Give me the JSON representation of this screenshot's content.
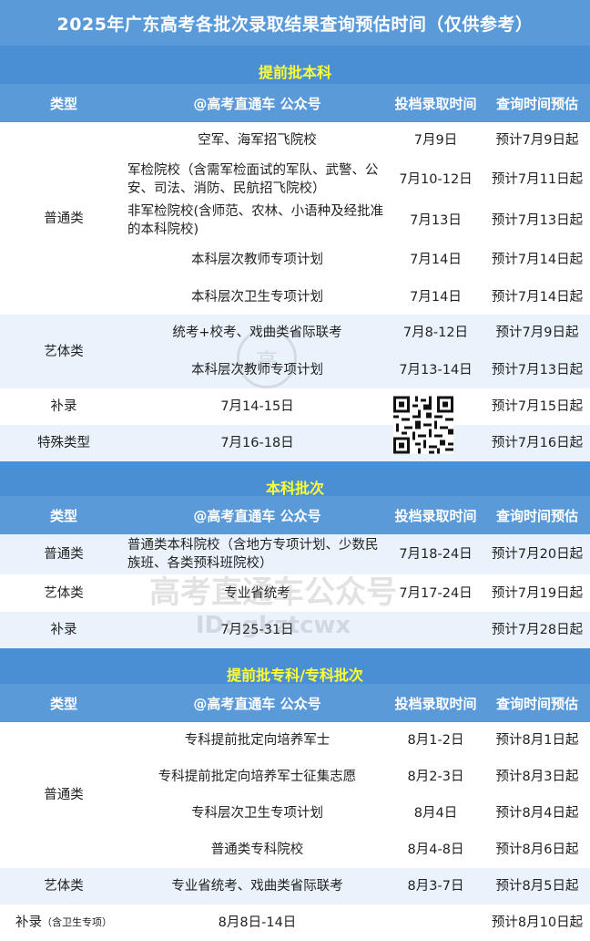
{
  "title": "2025年广东高考各批次录取结果查询预估时间（仅供参考）",
  "headers": {
    "type": "类型",
    "account": "@高考直通车 公众号",
    "admit": "投档录取时间",
    "query": "查询时间预估"
  },
  "sections": [
    {
      "title": "提前批本科"
    },
    {
      "title": "本科批次"
    },
    {
      "title": "提前批专科/专科批次"
    }
  ],
  "sec1": {
    "putong": "普通类",
    "r1": {
      "name": "空军、海军招飞院校",
      "time": "7月9日",
      "query": "预计7月9日起"
    },
    "r2": {
      "name": "军检院校（含需军检面试的军队、武警、公安、司法、消防、民航招飞院校）",
      "time": "7月10-12日",
      "query": "预计7月11日起"
    },
    "r3": {
      "name": "非军检院校(含师范、农林、小语种及经批准的本科院校)",
      "time": "7月13日",
      "query": "预计7月13日起"
    },
    "r4": {
      "name": "本科层次教师专项计划",
      "time": "7月14日",
      "query": "预计7月14日起"
    },
    "r5": {
      "name": "本科层次卫生专项计划",
      "time": "7月14日",
      "query": "预计7月14日起"
    },
    "yiti": "艺体类",
    "r6": {
      "name": "统考+校考、戏曲类省际联考",
      "time": "7月8-12日",
      "query": "预计7月9日起"
    },
    "r7": {
      "name": "本科层次教师专项计划",
      "time": "7月13-14日",
      "query": "预计7月13日起"
    },
    "bulu": {
      "type": "补录",
      "time": "7月14-15日",
      "query": "预计7月15日起"
    },
    "teshu": {
      "type": "特殊类型",
      "time": "7月16-18日",
      "query": "预计7月16日起"
    }
  },
  "sec2": {
    "r1": {
      "type": "普通类",
      "name": "普通类本科院校（含地方专项计划、少数民族班、各类预科班院校）",
      "time": "7月18-24日",
      "query": "预计7月20日起"
    },
    "r2": {
      "type": "艺体类",
      "name": "专业省统考",
      "time": "7月17-24日",
      "query": "预计7月19日起"
    },
    "r3": {
      "type": "补录",
      "time": "7月25-31日",
      "query": "预计7月28日起"
    }
  },
  "sec3": {
    "putong": "普通类",
    "r1": {
      "name": "专科提前批定向培养军士",
      "time": "8月1-2日",
      "query": "预计8月1日起"
    },
    "r2": {
      "name": "专科提前批定向培养军士征集志愿",
      "time": "8月2-3日",
      "query": "预计8月3日起"
    },
    "r3": {
      "name": "专科层次卫生专项计划",
      "time": "8月4日",
      "query": "预计8月4日起"
    },
    "r4": {
      "name": "普通类专科院校",
      "time": "8月4-8日",
      "query": "预计8月6日起"
    },
    "r5": {
      "type": "艺体类",
      "name": "专业省统考、戏曲类省际联考",
      "time": "8月3-7日",
      "query": "预计8月5日起"
    },
    "r6": {
      "type": "补录",
      "type_note": "（含卫生专项）",
      "time": "8月8日-14日",
      "query": "预计8月10日起"
    }
  },
  "watermark": {
    "line1": "高考直通车公众号",
    "line2": "ID: gkztcwx",
    "badge": "高"
  },
  "colors": {
    "header": "#5a9ad9",
    "section": "#4a8fd4",
    "section_text": "#ffff33",
    "band": "#eaf2fb"
  }
}
